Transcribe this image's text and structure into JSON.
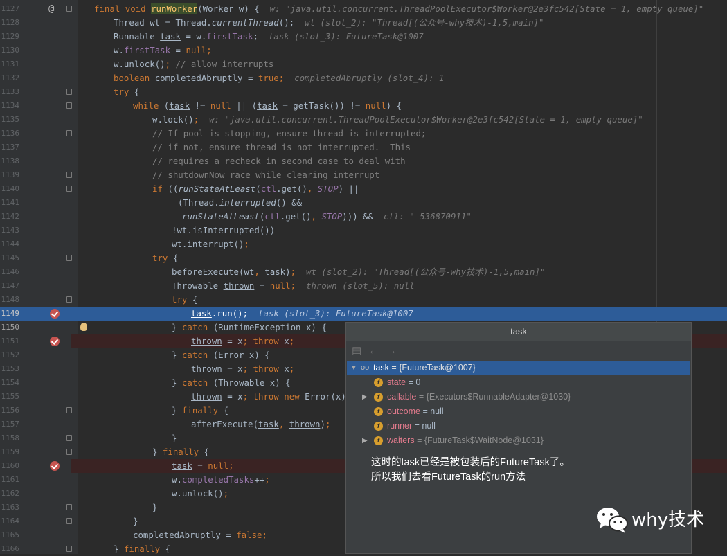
{
  "editor": {
    "lines": [
      {
        "n": "1127",
        "h": "w: \"java.util.concurrent.ThreadPoolExecutor$Worker@2e3fc542[State = 1, empty queue]\""
      },
      {
        "n": "1128",
        "h": "wt (slot_2): \"Thread[(公众号-why技术)-1,5,main]\""
      },
      {
        "n": "1129",
        "h": "task (slot_3): FutureTask@1007"
      },
      {
        "n": "1130",
        "h": ""
      },
      {
        "n": "1131",
        "c": "// allow interrupts"
      },
      {
        "n": "1132",
        "h": "completedAbruptly (slot_4): 1"
      },
      {
        "n": "1133"
      },
      {
        "n": "1134"
      },
      {
        "n": "1135",
        "h": "w: \"java.util.concurrent.ThreadPoolExecutor$Worker@2e3fc542[State = 1, empty queue]\""
      },
      {
        "n": "1136",
        "c": "// If pool is stopping, ensure thread is interrupted;"
      },
      {
        "n": "1137",
        "c": "// if not, ensure thread is not interrupted.  This"
      },
      {
        "n": "1138",
        "c": "// requires a recheck in second case to deal with"
      },
      {
        "n": "1139",
        "c": "// shutdownNow race while clearing interrupt"
      },
      {
        "n": "1140"
      },
      {
        "n": "1141"
      },
      {
        "n": "1142",
        "h": "ctl: \"-536870911\""
      },
      {
        "n": "1143"
      },
      {
        "n": "1144"
      },
      {
        "n": "1145"
      },
      {
        "n": "1146",
        "h": "wt (slot_2): \"Thread[(公众号-why技术)-1,5,main]\""
      },
      {
        "n": "1147",
        "h": "thrown (slot_5): null"
      },
      {
        "n": "1148"
      },
      {
        "n": "1149",
        "h": "task (slot_3): FutureTask@1007"
      },
      {
        "n": "1150"
      },
      {
        "n": "1151"
      },
      {
        "n": "1152"
      },
      {
        "n": "1153"
      },
      {
        "n": "1154"
      },
      {
        "n": "1155"
      },
      {
        "n": "1156"
      },
      {
        "n": "1157"
      },
      {
        "n": "1158"
      },
      {
        "n": "1159"
      },
      {
        "n": "1160"
      },
      {
        "n": "1161"
      },
      {
        "n": "1162"
      },
      {
        "n": "1163"
      },
      {
        "n": "1164"
      },
      {
        "n": "1165"
      },
      {
        "n": "1166"
      }
    ]
  },
  "popup": {
    "title": "task",
    "rows": [
      {
        "name": "task",
        "value": "= {FutureTask@1007}"
      },
      {
        "name": "state",
        "value": "= 0"
      },
      {
        "name": "callable",
        "value": "= {Executors$RunnableAdapter@1030}"
      },
      {
        "name": "outcome",
        "value": "= null"
      },
      {
        "name": "runner",
        "value": "= null"
      },
      {
        "name": "waiters",
        "value": "= {FutureTask$WaitNode@1031}"
      }
    ],
    "note_line1": "这时的task已经是被包装后的FutureTask了。",
    "note_line2": "所以我们去看FutureTask的run方法"
  },
  "watermark": {
    "text": "why技术"
  },
  "colors": {
    "background": "#2b2b2b",
    "gutter": "#313335",
    "execution_line": "#2d5c98",
    "breakpoint_line": "#3a2323",
    "breakpoint": "#c75450",
    "keyword": "#cc7832",
    "field": "#9876aa",
    "method": "#ffc66d",
    "string": "#6a8759",
    "comment": "#808080",
    "popup_bg": "#3c3f41",
    "variable_name": "#e07a8c"
  }
}
